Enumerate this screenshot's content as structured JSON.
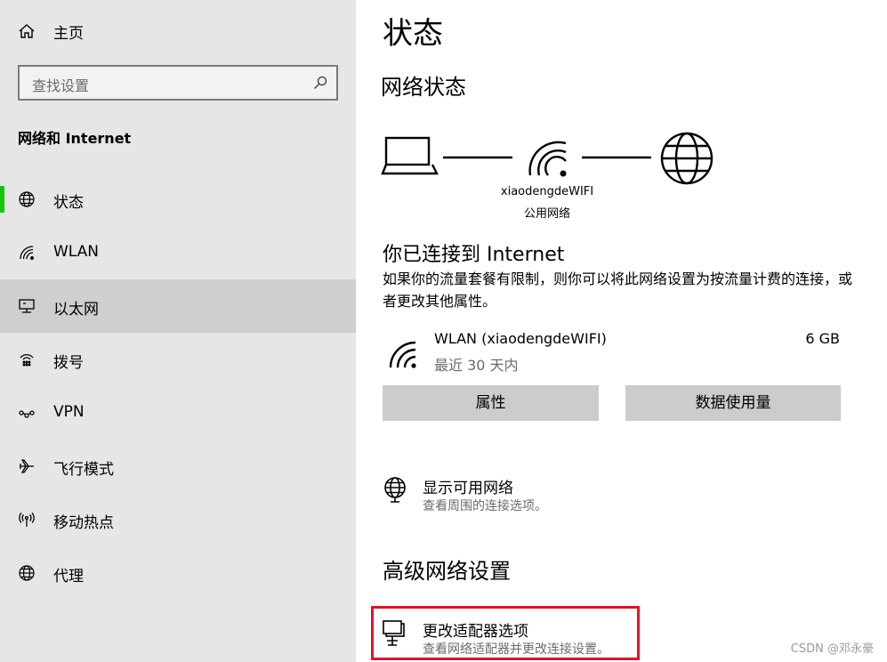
{
  "sidebar": {
    "home_label": "主页",
    "search_placeholder": "查找设置",
    "section_title": "网络和 Internet",
    "items": [
      {
        "label": "状态",
        "icon": "globe-icon"
      },
      {
        "label": "WLAN",
        "icon": "wifi-icon"
      },
      {
        "label": "以太网",
        "icon": "ethernet-icon"
      },
      {
        "label": "拨号",
        "icon": "dialup-icon"
      },
      {
        "label": "VPN",
        "icon": "vpn-icon"
      },
      {
        "label": "飞行模式",
        "icon": "airplane-icon"
      },
      {
        "label": "移动热点",
        "icon": "hotspot-icon"
      },
      {
        "label": "代理",
        "icon": "globe-icon"
      }
    ],
    "active_indicator_color": "#16c60c"
  },
  "main": {
    "title": "状态",
    "network_status_heading": "网络状态",
    "diagram": {
      "ssid": "xiaodengdeWIFI",
      "network_type": "公用网络"
    },
    "connected_heading": "你已连接到 Internet",
    "description": "如果你的流量套餐有限制，则你可以将此网络设置为按流量计费的连接，或者更改其他属性。",
    "connection": {
      "name": "WLAN (xiaodengdeWIFI)",
      "usage": "6 GB",
      "period": "最近 30 天内"
    },
    "buttons": {
      "properties": "属性",
      "data_usage": "数据使用量"
    },
    "show_networks": {
      "title": "显示可用网络",
      "subtitle": "查看周围的连接选项。"
    },
    "advanced_heading": "高级网络设置",
    "adapter_options": {
      "title": "更改适配器选项",
      "subtitle": "查看网络适配器并更改连接设置。"
    },
    "highlight_color": "#e81123"
  },
  "watermark": "CSDN @邓永豪"
}
